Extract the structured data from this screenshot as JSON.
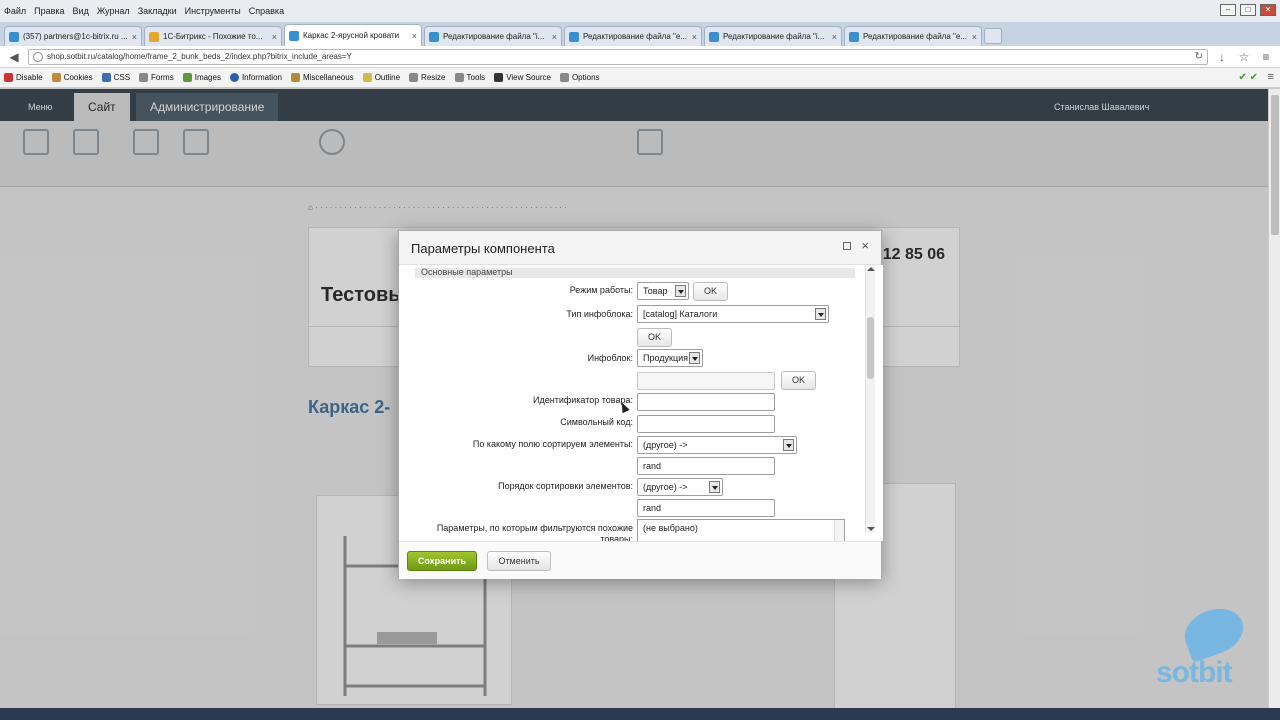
{
  "menubar": {
    "items": [
      "Файл",
      "Правка",
      "Вид",
      "Журнал",
      "Закладки",
      "Инструменты",
      "Справка"
    ]
  },
  "tabs": [
    {
      "label": "(357) partners@1c-bitrix.ru ..."
    },
    {
      "label": "1С-Битрикс - Похожие то..."
    },
    {
      "label": "Каркас 2-ярусной кровати"
    },
    {
      "label": "Редактирование файла \"i..."
    },
    {
      "label": "Редактирование файла \"e..."
    },
    {
      "label": "Редактирование файла \"i..."
    },
    {
      "label": "Редактирование файла \"e..."
    }
  ],
  "address": {
    "url": "shop.sotbit.ru/catalog/home/frame_2_bunk_beds_2/index.php?bitrix_include_areas=Y"
  },
  "devbar": {
    "items": [
      "Disable",
      "Cookies",
      "CSS",
      "Forms",
      "Images",
      "Information",
      "Miscellaneous",
      "Outline",
      "Resize",
      "Tools",
      "View Source",
      "Options"
    ]
  },
  "page": {
    "admin_tabs": [
      "Меню",
      "Сайт",
      "Администрирование"
    ],
    "user": "Станислав Шавалевич",
    "logo": "Тестовы",
    "phone": "12 85 06",
    "title": "Каркас 2-"
  },
  "dialog": {
    "title": "Параметры компонента",
    "section": "Основные параметры",
    "rows": [
      {
        "label": "Режим работы:",
        "value": "Товар"
      },
      {
        "label": "Тип инфоблока:",
        "value": "[catalog] Каталоги"
      },
      {
        "label": "Инфоблок:",
        "value": "Продукция"
      },
      {
        "label": "Идентификатор товара:",
        "value": ""
      },
      {
        "label": "Символьный код:",
        "value": ""
      },
      {
        "label": "По какому полю сортируем элементы:",
        "value": "(другое) ->",
        "extra": "rand"
      },
      {
        "label": "Порядок сортировки элементов:",
        "value": "(другое) ->",
        "extra": "rand"
      },
      {
        "label": "Параметры, по которым фильтруются похожие товары:",
        "value": "(не выбрано)"
      }
    ],
    "ok_label": "OK",
    "save_label": "Сохранить",
    "cancel_label": "Отменить"
  },
  "watermark": "sotbit"
}
